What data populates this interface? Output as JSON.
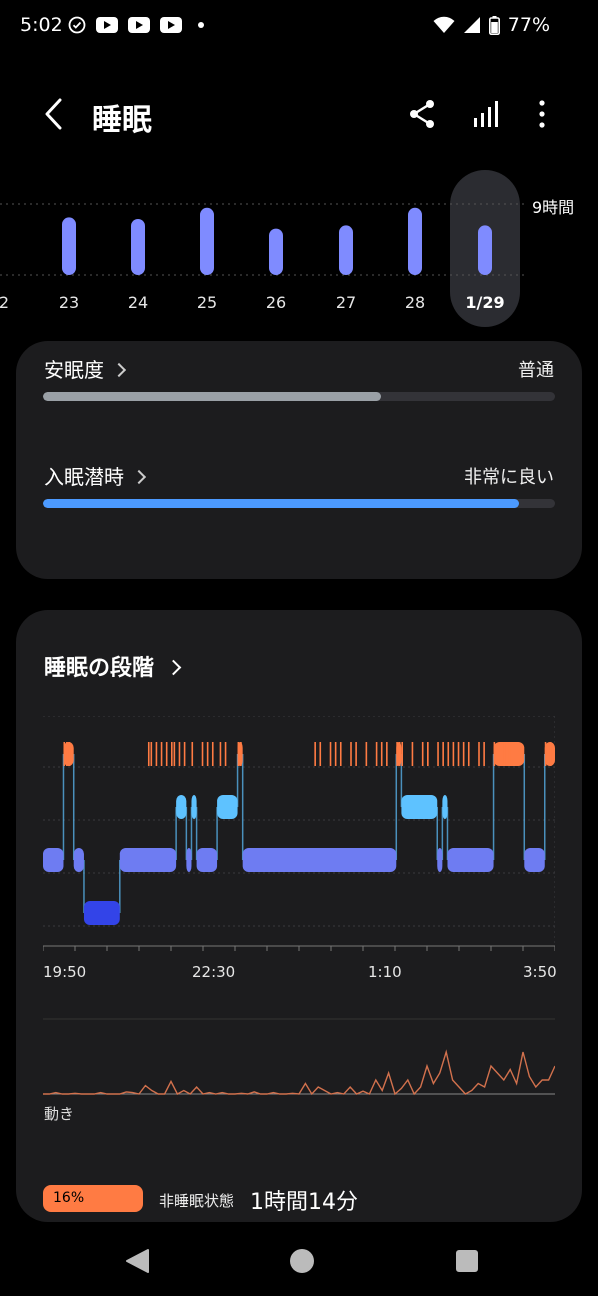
{
  "status": {
    "time": "5:02",
    "battery": "77%"
  },
  "header": {
    "title": "睡眠"
  },
  "week_chart": {
    "range_label": "9時間",
    "days": [
      {
        "label": "2",
        "value": 0.7
      },
      {
        "label": "23",
        "value": 0.72
      },
      {
        "label": "24",
        "value": 0.7
      },
      {
        "label": "25",
        "value": 0.84
      },
      {
        "label": "26",
        "value": 0.58
      },
      {
        "label": "27",
        "value": 0.62
      },
      {
        "label": "28",
        "value": 0.84
      },
      {
        "label": "1/29",
        "value": 0.62
      }
    ],
    "selected_index": 7,
    "bar_color": "#7f8bff"
  },
  "quality": {
    "label": "安眠度",
    "value": "普通",
    "progress": 0.66,
    "color": "#9aa0a6"
  },
  "latency": {
    "label": "入眠潜時",
    "value": "非常に良い",
    "progress": 0.93,
    "color": "#4c9aff"
  },
  "stages": {
    "title": "睡眠の段階",
    "time_labels": [
      "19:50",
      "22:30",
      "1:10",
      "3:50"
    ],
    "colors": {
      "awake": "#ff7b43",
      "rem": "#5ec2ff",
      "light": "#6e7cf2",
      "deep": "#3344e8"
    },
    "segments": [
      {
        "start": 0.0,
        "end": 0.04,
        "stage": "light"
      },
      {
        "start": 0.04,
        "end": 0.06,
        "stage": "awake"
      },
      {
        "start": 0.06,
        "end": 0.08,
        "stage": "light"
      },
      {
        "start": 0.08,
        "end": 0.15,
        "stage": "deep"
      },
      {
        "start": 0.15,
        "end": 0.26,
        "stage": "light"
      },
      {
        "start": 0.26,
        "end": 0.28,
        "stage": "rem"
      },
      {
        "start": 0.28,
        "end": 0.29,
        "stage": "light"
      },
      {
        "start": 0.29,
        "end": 0.3,
        "stage": "rem"
      },
      {
        "start": 0.3,
        "end": 0.34,
        "stage": "light"
      },
      {
        "start": 0.34,
        "end": 0.38,
        "stage": "rem"
      },
      {
        "start": 0.38,
        "end": 0.39,
        "stage": "awake"
      },
      {
        "start": 0.39,
        "end": 0.69,
        "stage": "light"
      },
      {
        "start": 0.69,
        "end": 0.7,
        "stage": "awake"
      },
      {
        "start": 0.7,
        "end": 0.77,
        "stage": "rem"
      },
      {
        "start": 0.77,
        "end": 0.78,
        "stage": "light"
      },
      {
        "start": 0.78,
        "end": 0.79,
        "stage": "rem"
      },
      {
        "start": 0.79,
        "end": 0.88,
        "stage": "light"
      },
      {
        "start": 0.88,
        "end": 0.94,
        "stage": "awake"
      },
      {
        "start": 0.94,
        "end": 0.98,
        "stage": "light"
      },
      {
        "start": 0.98,
        "end": 1.0,
        "stage": "awake"
      }
    ],
    "awake_ticks": [
      0.04,
      0.045,
      0.05,
      0.205,
      0.21,
      0.22,
      0.23,
      0.24,
      0.25,
      0.255,
      0.265,
      0.275,
      0.29,
      0.31,
      0.32,
      0.33,
      0.345,
      0.355,
      0.38,
      0.385,
      0.53,
      0.54,
      0.56,
      0.57,
      0.58,
      0.6,
      0.61,
      0.63,
      0.65,
      0.66,
      0.67,
      0.69,
      0.695,
      0.7,
      0.72,
      0.74,
      0.75,
      0.75,
      0.77,
      0.78,
      0.79,
      0.8,
      0.81,
      0.82,
      0.83,
      0.85,
      0.86,
      0.88,
      0.9,
      0.91,
      0.98,
      0.99
    ],
    "movement_label": "動き",
    "movement": [
      0,
      0,
      0.02,
      0,
      0,
      0.01,
      0,
      0,
      0,
      0.02,
      0,
      0,
      0,
      0.03,
      0.02,
      0,
      0.12,
      0.05,
      0,
      0,
      0.18,
      0,
      0.05,
      0,
      0.1,
      0,
      0.02,
      0,
      0.02,
      0,
      0,
      0.01,
      0,
      0.03,
      0,
      0,
      0.02,
      0,
      0,
      0.01,
      0,
      0.15,
      0,
      0.1,
      0.05,
      0,
      0.02,
      0,
      0.1,
      0,
      0.04,
      0,
      0.2,
      0.05,
      0.3,
      0,
      0.08,
      0.2,
      0,
      0.1,
      0.4,
      0.15,
      0.3,
      0.6,
      0.2,
      0.1,
      0,
      0.05,
      0.15,
      0.1,
      0.4,
      0.3,
      0.2,
      0.35,
      0.15,
      0.6,
      0.25,
      0.1,
      0.2,
      0.2,
      0.4
    ],
    "movement_color": "#d2714d",
    "awake_pct": "16%",
    "awake_label": "非睡眠状態",
    "awake_duration": "1時間14分"
  }
}
